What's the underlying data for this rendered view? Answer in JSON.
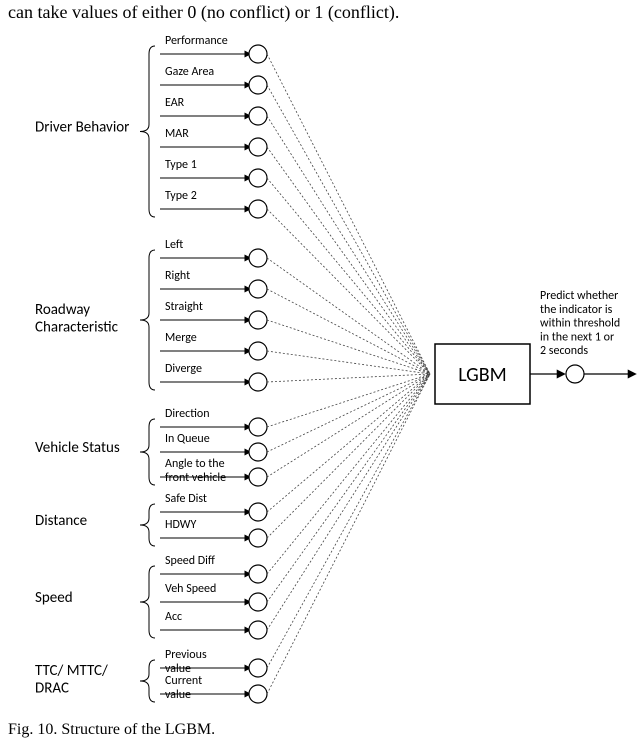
{
  "top_text": "can take values of either 0 (no conflict) or 1 (conflict).",
  "caption": "Fig. 10.  Structure of the LGBM.",
  "model_label": "LGBM",
  "output_text": [
    "Predict whether",
    "the indicator is",
    "within threshold",
    "in the next 1 or",
    "2 seconds"
  ],
  "groups": [
    {
      "label": "Driver Behavior",
      "features": [
        "Performance",
        "Gaze Area",
        "EAR",
        "MAR",
        "Type 1",
        "Type 2"
      ]
    },
    {
      "label": "Roadway\nCharacteristic",
      "features": [
        "Left",
        "Right",
        "Straight",
        "Merge",
        "Diverge"
      ]
    },
    {
      "label": "Vehicle Status",
      "features": [
        "Direction",
        "In Queue",
        "Angle to the\nfront vehicle"
      ]
    },
    {
      "label": "Distance",
      "features": [
        "Safe Dist",
        "HDWY"
      ]
    },
    {
      "label": "Speed",
      "features": [
        "Speed Diff",
        "Veh Speed",
        "Acc"
      ]
    },
    {
      "label": "TTC/ MTTC/\nDRAC",
      "features": [
        "Previous\nvalue",
        "Current\nvalue"
      ]
    }
  ]
}
